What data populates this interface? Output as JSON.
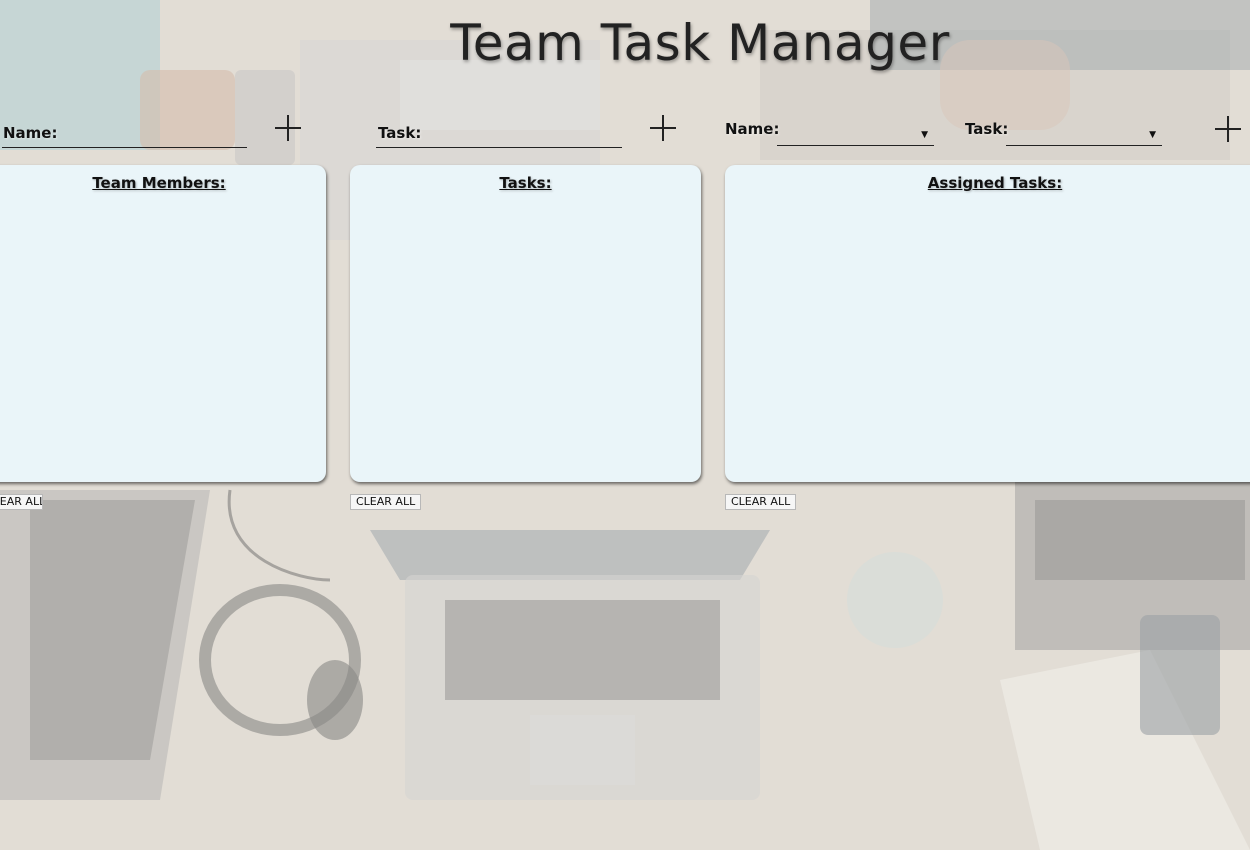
{
  "app": {
    "title": "Team Task Manager"
  },
  "add_member": {
    "label": "Name:",
    "value": "",
    "button_icon": "plus-icon"
  },
  "add_task": {
    "label": "Task:",
    "value": "",
    "button_icon": "plus-icon"
  },
  "assign": {
    "name_label": "Name:",
    "name_selected": "",
    "task_label": "Task:",
    "task_selected": "",
    "button_icon": "plus-icon"
  },
  "panels": {
    "members": {
      "heading": "Team Members:",
      "items": [],
      "clear_label": "CLEAR ALL"
    },
    "tasks": {
      "heading": "Tasks:",
      "items": [],
      "clear_label": "CLEAR ALL"
    },
    "assigned": {
      "heading": "Assigned Tasks:",
      "items": [],
      "clear_label": "CLEAR ALL"
    }
  },
  "colors": {
    "panel_bg": "#eaf5f9",
    "text": "#111111"
  }
}
